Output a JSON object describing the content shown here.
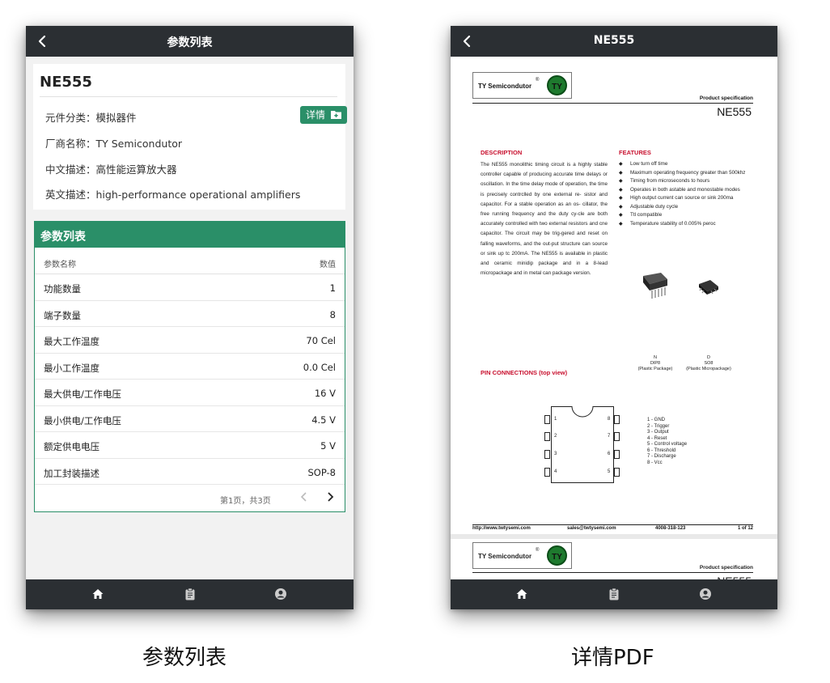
{
  "left_screen": {
    "title": "参数列表",
    "part_name": "NE555",
    "info": {
      "category": "元件分类：模拟器件",
      "manufacturer": "厂商名称：TY Semicondutor",
      "cn_desc": "中文描述：高性能运算放大器",
      "en_desc": "英文描述：high-performance operational amplifiers"
    },
    "detail_button": "详情",
    "panel_title": "参数列表",
    "col_name": "参数名称",
    "col_value": "数值",
    "rows": [
      {
        "name": "功能数量",
        "value": "1"
      },
      {
        "name": "端子数量",
        "value": "8"
      },
      {
        "name": "最大工作温度",
        "value": "70 Cel"
      },
      {
        "name": "最小工作温度",
        "value": "0.0 Cel"
      },
      {
        "name": "最大供电/工作电压",
        "value": "16 V"
      },
      {
        "name": "最小供电/工作电压",
        "value": "4.5 V"
      },
      {
        "name": "额定供电电压",
        "value": "5 V"
      },
      {
        "name": "加工封装描述",
        "value": "SOP-8"
      }
    ],
    "pager": "第1页，共3页"
  },
  "right_screen": {
    "title": "NE555",
    "pdf": {
      "logo_text": "TY Semicondutor",
      "logo_reg": "®",
      "logo_mark": "TY",
      "spec_label": "Product specification",
      "part": "NE555",
      "desc_title": "DESCRIPTION",
      "desc_body": "The NE555 monolithic timing circuit is a highly stable controller capable of producing accurate time delays or oscillation. In the time delay mode of operation, the time is precisely contrclled by one external re- sistor and capacitor. For a stable operation as an os- cillator, the free running frequency and the duty cy-cle are both accurately controlled with two external resistors and cne capacitor. The circuit may be trig-gered and reset on falling waveforms, and the out-put structure can source or sink up tc 200mA. The NE555 is available in plastic and ceramic minidip package and in a 8-lead micropackage and in metal can package version.",
      "features_title": "FEATURES",
      "features": [
        "Low turn off time",
        "Maximum operating frequency greater than 500khz",
        "Timing from microseconds to hours",
        "Operates in both astable and monostable modes",
        "High output current can source or sink 200ma",
        "Adjustable duty cycle",
        "Ttl compatible",
        "Temperature stability of 0.005% peroc"
      ],
      "pkg1": {
        "l1": "N",
        "l2": "DIP8",
        "l3": "(Plastic Package)"
      },
      "pkg2": {
        "l1": "D",
        "l2": "SO8",
        "l3": "(Plastic Micropackage)"
      },
      "pin_title": "PIN CONNECTIONS (top view)",
      "pins": [
        "1 - GND",
        "2 - Trigger",
        "3 - Output",
        "4 - Reset",
        "5 - Control voltage",
        "6 - Threshold",
        "7 - Discharge",
        "8 - Vcc"
      ],
      "pin_nums_left": [
        "1",
        "2",
        "3",
        "4"
      ],
      "pin_nums_right": [
        "8",
        "7",
        "6",
        "5"
      ],
      "footer": {
        "url": "http://www.twtysemi.com",
        "email": "sales@twtysemi.com",
        "phone": "4008-318-123",
        "page": "1 of 12"
      }
    }
  },
  "captions": {
    "left": "参数列表",
    "right": "详情PDF"
  }
}
